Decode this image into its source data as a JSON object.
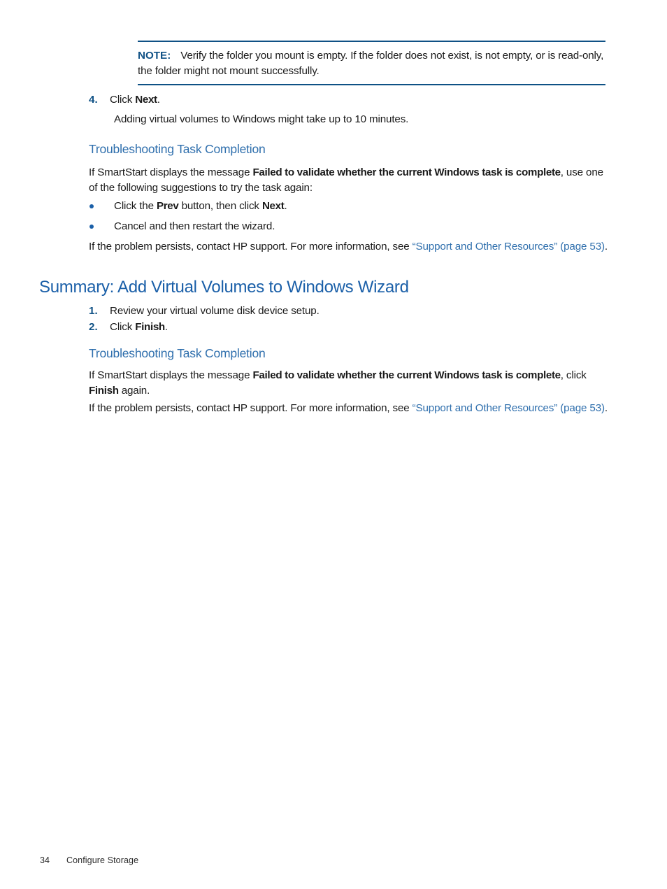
{
  "note": {
    "label": "NOTE:",
    "text": "Verify the folder you mount is empty. If the folder does not exist, is not empty, or is read-only, the folder might not mount successfully."
  },
  "step4": {
    "number": "4.",
    "text_prefix": "Click ",
    "text_bold": "Next",
    "text_suffix": ".",
    "continuation": "Adding virtual volumes to Windows might take up to 10 minutes."
  },
  "troubleshooting_1": {
    "heading": "Troubleshooting Task Completion",
    "intro_prefix": "If SmartStart displays the message ",
    "intro_bold": "Failed to validate whether the current Windows task is complete",
    "intro_suffix": ", use one of the following suggestions to try the task again:",
    "bullets": [
      {
        "prefix": "Click the ",
        "bold1": "Prev",
        "mid": " button, then click ",
        "bold2": "Next",
        "suffix": "."
      },
      {
        "prefix": "Cancel and then restart the wizard.",
        "bold1": "",
        "mid": "",
        "bold2": "",
        "suffix": ""
      }
    ],
    "persist_prefix": "If the problem persists, contact HP support. For more information, see ",
    "persist_link": "“Support and Other Resources” (page 53)",
    "persist_suffix": "."
  },
  "summary_section": {
    "heading": "Summary: Add Virtual Volumes to Windows Wizard",
    "steps": [
      {
        "number": "1.",
        "prefix": "Review your virtual volume disk device setup.",
        "bold": "",
        "suffix": ""
      },
      {
        "number": "2.",
        "prefix": "Click ",
        "bold": "Finish",
        "suffix": "."
      }
    ]
  },
  "troubleshooting_2": {
    "heading": "Troubleshooting Task Completion",
    "intro_prefix": "If SmartStart displays the message ",
    "intro_bold": "Failed to validate whether the current Windows task is complete",
    "intro_mid": ", click ",
    "intro_bold2": "Finish",
    "intro_suffix": " again.",
    "persist_prefix": "If the problem persists, contact HP support. For more information, see ",
    "persist_link": "“Support and Other Resources” (page 53)",
    "persist_suffix": "."
  },
  "footer": {
    "page_number": "34",
    "chapter": "Configure Storage"
  },
  "colors": {
    "heading_blue": "#1a5fa8",
    "subheading_blue": "#2f6fad",
    "note_rule_blue": "#0f5185",
    "link_blue": "#2f6fad",
    "body_black": "#1a1a1a"
  }
}
